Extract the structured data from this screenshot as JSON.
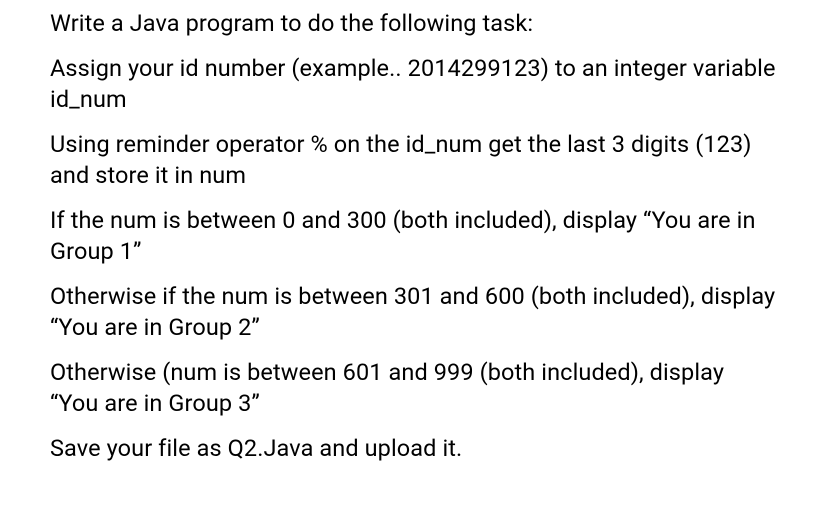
{
  "paragraphs": {
    "p1": "Write a Java program to do the following task:",
    "p2": "Assign your id number (example.. 2014299123) to an integer variable id_num",
    "p3": "Using reminder operator % on the id_num get the last 3 digits (123) and store it in num",
    "p4": "If the num is between 0 and 300 (both included), display “You are in Group 1”",
    "p5": "Otherwise if the num is between 301 and 600 (both included), display “You are in Group 2”",
    "p6": "Otherwise (num is between 601 and 999 (both included), display “You are in Group 3”",
    "p7": "Save your file as Q2.Java and upload it."
  }
}
